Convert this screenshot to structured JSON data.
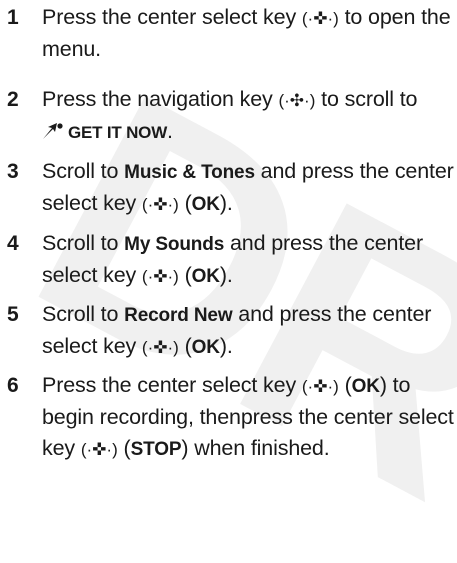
{
  "watermark": "DR",
  "icons": {
    "center_select": "(·✜·)",
    "navigation": "(·✣·)",
    "get_it_now": "get-it-now-icon"
  },
  "steps": [
    {
      "num": "1",
      "a": "Press the center select key ",
      "b": " to open the menu."
    },
    {
      "num": "2",
      "a": "Press the navigation key ",
      "b": " to scroll to",
      "c": "GET IT NOW",
      "d": "."
    },
    {
      "num": "3",
      "a": "Scroll to ",
      "bold1": "Music & Tones",
      "b": " and press the center select key ",
      "c": " (",
      "bold2": "OK",
      "d": ")."
    },
    {
      "num": "4",
      "a": "Scroll to ",
      "bold1": "My Sounds",
      "b": " and press the center select key ",
      "c": " (",
      "bold2": "OK",
      "d": ")."
    },
    {
      "num": "5",
      "a": "Scroll to ",
      "bold1": "Record New",
      "b": " and press the center select key ",
      "c": " (",
      "bold2": "OK",
      "d": ")."
    },
    {
      "num": "6",
      "a": "Press the center select key ",
      "b": " (",
      "bold1": "OK",
      "c": ") to begin recording, thenpress the center select key ",
      "d": " (",
      "bold2": "STOP",
      "e": ") when finished."
    }
  ]
}
